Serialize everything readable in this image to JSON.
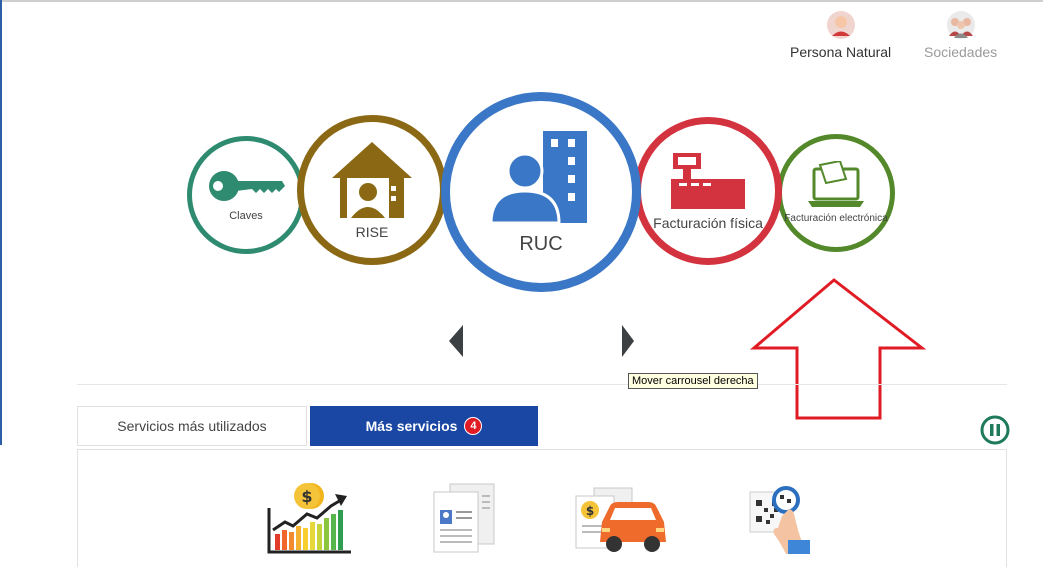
{
  "user_types": {
    "natural_label": "Persona Natural",
    "sociedades_label": "Sociedades"
  },
  "carousel": {
    "items": [
      {
        "label": "Claves",
        "color": "#2e8b70",
        "icon": "key-icon"
      },
      {
        "label": "RISE",
        "color": "#8b6914",
        "icon": "house-person-icon"
      },
      {
        "label": "RUC",
        "color": "#3a77c6",
        "icon": "person-building-icon"
      },
      {
        "label": "Facturación física",
        "color": "#d3323f",
        "icon": "cash-register-icon"
      },
      {
        "label": "Facturación electrónica",
        "color": "#54892b",
        "icon": "laptop-invoice-icon"
      }
    ],
    "prev_icon": "chevron-left-icon",
    "next_icon": "chevron-right-icon",
    "next_tooltip": "Mover carrousel derecha"
  },
  "annotation": {
    "color": "#e01b24",
    "icon": "up-arrow-outline-icon"
  },
  "tabs": [
    {
      "label": "Servicios más utilizados"
    },
    {
      "label": "Más servicios",
      "badge": "4"
    }
  ],
  "pause_icon": "pause-icon",
  "services": [
    {
      "icon": "growth-chart-icon"
    },
    {
      "icon": "documents-icon"
    },
    {
      "icon": "car-tax-icon"
    },
    {
      "icon": "qr-scan-icon"
    }
  ]
}
